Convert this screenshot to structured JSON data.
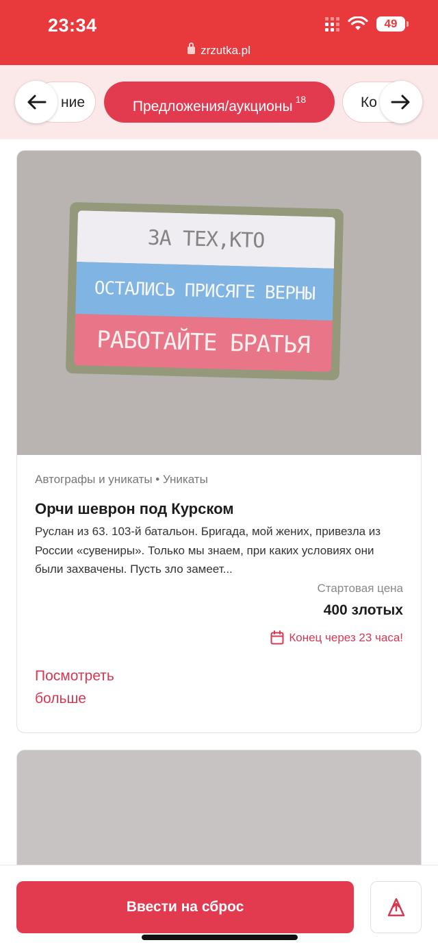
{
  "status_bar": {
    "time": "23:34",
    "battery": "49"
  },
  "browser": {
    "url": "zrzutka.pl"
  },
  "tabs": {
    "prev_label": "ние",
    "active_label": "Предложения/аукционы",
    "active_count": "18",
    "next_label": "Ко"
  },
  "listing": {
    "image_text": {
      "line1": "ЗА ТЕХ,КТО",
      "line2": "ОСТАЛИСЬ ПРИСЯГЕ ВЕРНЫ",
      "line3": "РАБОТАЙТЕ БРАТЬЯ"
    },
    "category": "Автографы и уникаты • Уникаты",
    "title": "Орчи шеврон под Курском",
    "description": "Руслан из 63. 103-й батальон. Бригада, мой жених, привезла из России «сувениры». Только мы знаем, при каких условиях они были захвачены. Пусть зло замеет...",
    "price_label": "Стартовая цена",
    "price": "400 злотых",
    "deadline": "Конец через 23 часа!",
    "more_link": "Посмотреть больше"
  },
  "bottom_bar": {
    "cta_label": "Ввести на сброс"
  },
  "colors": {
    "brand_red": "#e8393c",
    "accent_pink": "#e23b50",
    "tab_bg": "#fbe8e8"
  },
  "icons": [
    "arrow-left-icon",
    "arrow-right-icon",
    "calendar-icon",
    "share-icon",
    "lock-icon",
    "wifi-icon",
    "signal-icon"
  ]
}
